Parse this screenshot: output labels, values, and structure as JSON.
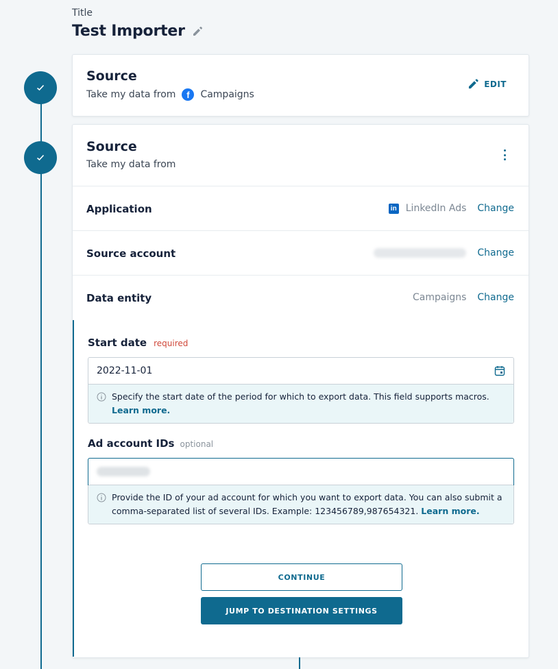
{
  "header": {
    "title_label": "Title",
    "title": "Test Importer"
  },
  "step1": {
    "heading": "Source",
    "subtitle": "Take my data from",
    "source_name": "Campaigns",
    "edit_label": "EDIT"
  },
  "step2": {
    "heading": "Source",
    "subtitle": "Take my data from",
    "rows": [
      {
        "label": "Application",
        "value": "LinkedIn Ads",
        "action": "Change"
      },
      {
        "label": "Source account",
        "value": "",
        "action": "Change"
      },
      {
        "label": "Data entity",
        "value": "Campaigns",
        "action": "Change"
      }
    ],
    "start_date": {
      "label": "Start date",
      "badge": "required",
      "value": "2022-11-01",
      "help": "Specify the start date of the period for which to export data. This field supports macros. ",
      "help_link": "Learn more."
    },
    "ad_account": {
      "label": "Ad account IDs",
      "badge": "optional",
      "value": "",
      "help": "Provide the ID of your ad account for which you want to export data. You can also submit a comma-separated list of several IDs. Example: 123456789,987654321. ",
      "help_link": "Learn more."
    },
    "continue_label": "CONTINUE",
    "jump_label": "JUMP TO DESTINATION SETTINGS"
  },
  "colors": {
    "accent": "#0f6a8f",
    "required": "#d0493b",
    "help_bg": "#eaf6f8"
  }
}
